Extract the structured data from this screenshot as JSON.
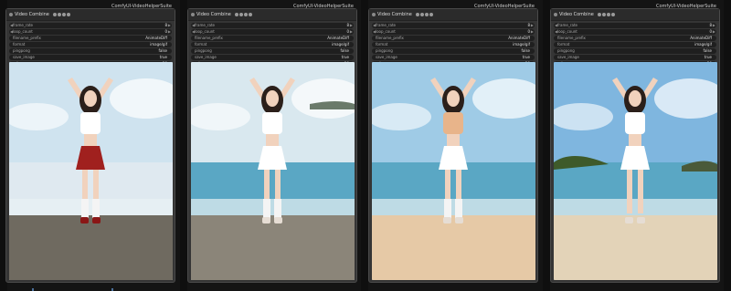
{
  "app": {
    "suite_label": "ComfyUI-VideoHelperSuite"
  },
  "nodes": [
    {
      "title": "Video Combine",
      "widgets": {
        "frame_rate": {
          "label": "frame_rate",
          "value": "8"
        },
        "loop_count": {
          "label": "loop_count",
          "value": "0"
        },
        "filename_prefix": {
          "label": "filename_prefix",
          "value": "AnimateDiff"
        },
        "format": {
          "label": "format",
          "value": "image/gif"
        },
        "pingpong": {
          "label": "pingpong",
          "value": "false"
        },
        "save_image": {
          "label": "save_image",
          "value": "true"
        },
        "crf": {
          "label": "crf",
          "value": "20"
        }
      },
      "scene": {
        "outfit": "red-skirt",
        "sky": "#cfe3ef",
        "ground": "#6f6a60"
      }
    },
    {
      "title": "Video Combine",
      "widgets": {
        "frame_rate": {
          "label": "frame_rate",
          "value": "8"
        },
        "loop_count": {
          "label": "loop_count",
          "value": "0"
        },
        "filename_prefix": {
          "label": "filename_prefix",
          "value": "AnimateDiff"
        },
        "format": {
          "label": "format",
          "value": "image/gif"
        },
        "pingpong": {
          "label": "pingpong",
          "value": "false"
        },
        "save_image": {
          "label": "save_image",
          "value": "true"
        },
        "crf": {
          "label": "crf",
          "value": "20"
        }
      },
      "scene": {
        "outfit": "white-skirt",
        "sky": "#d9e8ef",
        "ground": "#8b8579"
      }
    },
    {
      "title": "Video Combine",
      "widgets": {
        "frame_rate": {
          "label": "frame_rate",
          "value": "8"
        },
        "loop_count": {
          "label": "loop_count",
          "value": "0"
        },
        "filename_prefix": {
          "label": "filename_prefix",
          "value": "AnimateDiff"
        },
        "format": {
          "label": "format",
          "value": "image/gif"
        },
        "pingpong": {
          "label": "pingpong",
          "value": "false"
        },
        "save_image": {
          "label": "save_image",
          "value": "true"
        },
        "crf": {
          "label": "crf",
          "value": "20"
        }
      },
      "scene": {
        "outfit": "tan-top",
        "sky": "#9fcbe6",
        "ground": "#e6c9a6"
      }
    },
    {
      "title": "Video Combine",
      "widgets": {
        "frame_rate": {
          "label": "frame_rate",
          "value": "8"
        },
        "loop_count": {
          "label": "loop_count",
          "value": "0"
        },
        "filename_prefix": {
          "label": "filename_prefix",
          "value": "AnimateDiff"
        },
        "format": {
          "label": "format",
          "value": "image/gif"
        },
        "pingpong": {
          "label": "pingpong",
          "value": "false"
        },
        "save_image": {
          "label": "save_image",
          "value": "true"
        },
        "crf": {
          "label": "crf",
          "value": "20"
        }
      },
      "scene": {
        "outfit": "white-crop",
        "sky": "#7fb6df",
        "ground": "#e3d3b8"
      }
    }
  ]
}
